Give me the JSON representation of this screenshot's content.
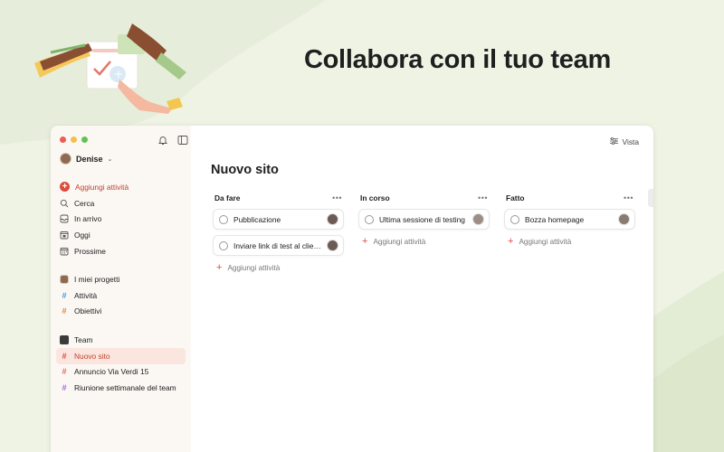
{
  "hero": {
    "title": "Collabora con il tuo team"
  },
  "colors": {
    "accent": "#dc4c3e",
    "active_bg": "#fbe6df",
    "background": "#eef3e4"
  },
  "sidebar": {
    "user": {
      "name": "Denise",
      "icon": "chevron-down-icon"
    },
    "top_icons": [
      "bell-icon",
      "sidebar-toggle-icon"
    ],
    "primary": [
      {
        "label": "Aggiungi attività",
        "icon": "plus-circle-icon"
      },
      {
        "label": "Cerca",
        "icon": "search-icon"
      },
      {
        "label": "In arrivo",
        "icon": "inbox-icon"
      },
      {
        "label": "Oggi",
        "icon": "calendar-today-icon"
      },
      {
        "label": "Prossime",
        "icon": "calendar-upcoming-icon"
      }
    ],
    "projects_header": "I miei progetti",
    "projects": [
      {
        "label": "Attività",
        "color": "#4a9ad4"
      },
      {
        "label": "Obiettivi",
        "color": "#e0893a"
      }
    ],
    "team_header": "Team",
    "team_projects": [
      {
        "label": "Nuovo sito",
        "color": "#dc4c3e",
        "active": true
      },
      {
        "label": "Annuncio Via Verdi 15",
        "color": "#e06a5a"
      },
      {
        "label": "Riunione settimanale del team",
        "color": "#a368d8"
      }
    ]
  },
  "main": {
    "view_label": "Vista",
    "title": "Nuovo sito",
    "columns": [
      {
        "title": "Da fare",
        "tasks": [
          "Pubblicazione",
          "Inviare link di test al clie…"
        ],
        "add_label": "Aggiungi attività"
      },
      {
        "title": "In corso",
        "tasks": [
          "Ultima sessione di testing"
        ],
        "add_label": "Aggiungi attività"
      },
      {
        "title": "Fatto",
        "tasks": [
          "Bozza homepage"
        ],
        "add_label": "Aggiungi attività"
      }
    ]
  }
}
